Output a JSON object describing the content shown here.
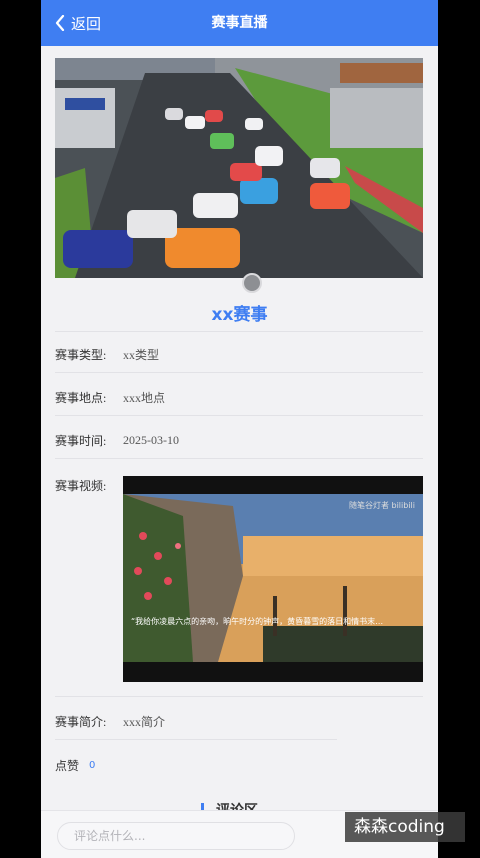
{
  "header": {
    "back_label": "返回",
    "title": "赛事直播"
  },
  "event": {
    "name": "xx赛事",
    "fields": [
      {
        "label": "赛事类型:",
        "value": "xx类型"
      },
      {
        "label": "赛事地点:",
        "value": "xxx地点"
      },
      {
        "label": "赛事时间:",
        "value": "2025-03-10"
      }
    ],
    "video_label": "赛事视频:",
    "video": {
      "corner_text": "随笔谷灯者 bilibili",
      "subtitle": "“我给你凌晨六点的亲吻，晌午时分的钟声，黄昏暮雪的落日和情书末…"
    },
    "intro": {
      "label": "赛事简介:",
      "value": "xxx简介"
    },
    "likes": {
      "label": "点赞",
      "count": "0"
    }
  },
  "comments": {
    "section_title": "评论区",
    "input_placeholder": "评论点什么..."
  },
  "watermark": "森森coding",
  "colors": {
    "accent": "#3f7ef2",
    "background": "#f2f2f4"
  }
}
